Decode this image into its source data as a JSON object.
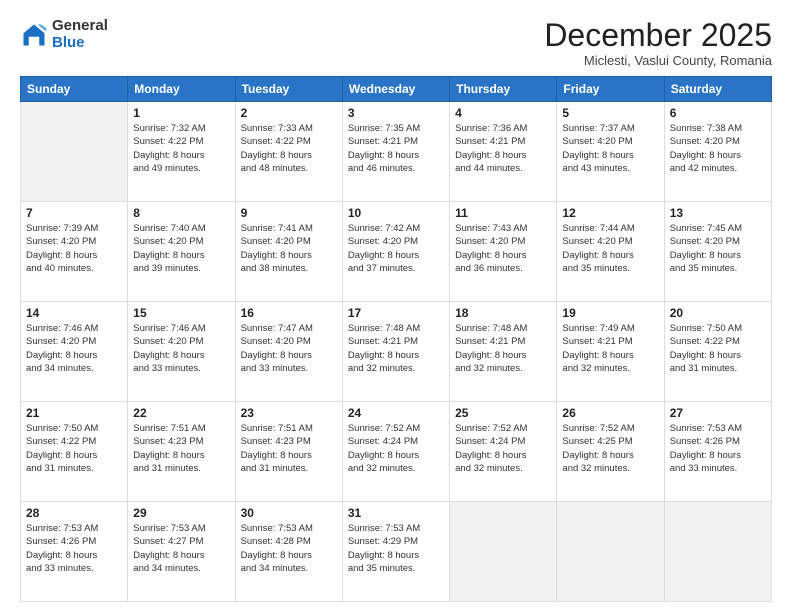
{
  "logo": {
    "general": "General",
    "blue": "Blue"
  },
  "header": {
    "month": "December 2025",
    "location": "Miclesti, Vaslui County, Romania"
  },
  "weekdays": [
    "Sunday",
    "Monday",
    "Tuesday",
    "Wednesday",
    "Thursday",
    "Friday",
    "Saturday"
  ],
  "rows": [
    [
      {
        "day": "",
        "info": ""
      },
      {
        "day": "1",
        "info": "Sunrise: 7:32 AM\nSunset: 4:22 PM\nDaylight: 8 hours\nand 49 minutes."
      },
      {
        "day": "2",
        "info": "Sunrise: 7:33 AM\nSunset: 4:22 PM\nDaylight: 8 hours\nand 48 minutes."
      },
      {
        "day": "3",
        "info": "Sunrise: 7:35 AM\nSunset: 4:21 PM\nDaylight: 8 hours\nand 46 minutes."
      },
      {
        "day": "4",
        "info": "Sunrise: 7:36 AM\nSunset: 4:21 PM\nDaylight: 8 hours\nand 44 minutes."
      },
      {
        "day": "5",
        "info": "Sunrise: 7:37 AM\nSunset: 4:20 PM\nDaylight: 8 hours\nand 43 minutes."
      },
      {
        "day": "6",
        "info": "Sunrise: 7:38 AM\nSunset: 4:20 PM\nDaylight: 8 hours\nand 42 minutes."
      }
    ],
    [
      {
        "day": "7",
        "info": "Sunrise: 7:39 AM\nSunset: 4:20 PM\nDaylight: 8 hours\nand 40 minutes."
      },
      {
        "day": "8",
        "info": "Sunrise: 7:40 AM\nSunset: 4:20 PM\nDaylight: 8 hours\nand 39 minutes."
      },
      {
        "day": "9",
        "info": "Sunrise: 7:41 AM\nSunset: 4:20 PM\nDaylight: 8 hours\nand 38 minutes."
      },
      {
        "day": "10",
        "info": "Sunrise: 7:42 AM\nSunset: 4:20 PM\nDaylight: 8 hours\nand 37 minutes."
      },
      {
        "day": "11",
        "info": "Sunrise: 7:43 AM\nSunset: 4:20 PM\nDaylight: 8 hours\nand 36 minutes."
      },
      {
        "day": "12",
        "info": "Sunrise: 7:44 AM\nSunset: 4:20 PM\nDaylight: 8 hours\nand 35 minutes."
      },
      {
        "day": "13",
        "info": "Sunrise: 7:45 AM\nSunset: 4:20 PM\nDaylight: 8 hours\nand 35 minutes."
      }
    ],
    [
      {
        "day": "14",
        "info": "Sunrise: 7:46 AM\nSunset: 4:20 PM\nDaylight: 8 hours\nand 34 minutes."
      },
      {
        "day": "15",
        "info": "Sunrise: 7:46 AM\nSunset: 4:20 PM\nDaylight: 8 hours\nand 33 minutes."
      },
      {
        "day": "16",
        "info": "Sunrise: 7:47 AM\nSunset: 4:20 PM\nDaylight: 8 hours\nand 33 minutes."
      },
      {
        "day": "17",
        "info": "Sunrise: 7:48 AM\nSunset: 4:21 PM\nDaylight: 8 hours\nand 32 minutes."
      },
      {
        "day": "18",
        "info": "Sunrise: 7:48 AM\nSunset: 4:21 PM\nDaylight: 8 hours\nand 32 minutes."
      },
      {
        "day": "19",
        "info": "Sunrise: 7:49 AM\nSunset: 4:21 PM\nDaylight: 8 hours\nand 32 minutes."
      },
      {
        "day": "20",
        "info": "Sunrise: 7:50 AM\nSunset: 4:22 PM\nDaylight: 8 hours\nand 31 minutes."
      }
    ],
    [
      {
        "day": "21",
        "info": "Sunrise: 7:50 AM\nSunset: 4:22 PM\nDaylight: 8 hours\nand 31 minutes."
      },
      {
        "day": "22",
        "info": "Sunrise: 7:51 AM\nSunset: 4:23 PM\nDaylight: 8 hours\nand 31 minutes."
      },
      {
        "day": "23",
        "info": "Sunrise: 7:51 AM\nSunset: 4:23 PM\nDaylight: 8 hours\nand 31 minutes."
      },
      {
        "day": "24",
        "info": "Sunrise: 7:52 AM\nSunset: 4:24 PM\nDaylight: 8 hours\nand 32 minutes."
      },
      {
        "day": "25",
        "info": "Sunrise: 7:52 AM\nSunset: 4:24 PM\nDaylight: 8 hours\nand 32 minutes."
      },
      {
        "day": "26",
        "info": "Sunrise: 7:52 AM\nSunset: 4:25 PM\nDaylight: 8 hours\nand 32 minutes."
      },
      {
        "day": "27",
        "info": "Sunrise: 7:53 AM\nSunset: 4:26 PM\nDaylight: 8 hours\nand 33 minutes."
      }
    ],
    [
      {
        "day": "28",
        "info": "Sunrise: 7:53 AM\nSunset: 4:26 PM\nDaylight: 8 hours\nand 33 minutes."
      },
      {
        "day": "29",
        "info": "Sunrise: 7:53 AM\nSunset: 4:27 PM\nDaylight: 8 hours\nand 34 minutes."
      },
      {
        "day": "30",
        "info": "Sunrise: 7:53 AM\nSunset: 4:28 PM\nDaylight: 8 hours\nand 34 minutes."
      },
      {
        "day": "31",
        "info": "Sunrise: 7:53 AM\nSunset: 4:29 PM\nDaylight: 8 hours\nand 35 minutes."
      },
      {
        "day": "",
        "info": ""
      },
      {
        "day": "",
        "info": ""
      },
      {
        "day": "",
        "info": ""
      }
    ]
  ]
}
